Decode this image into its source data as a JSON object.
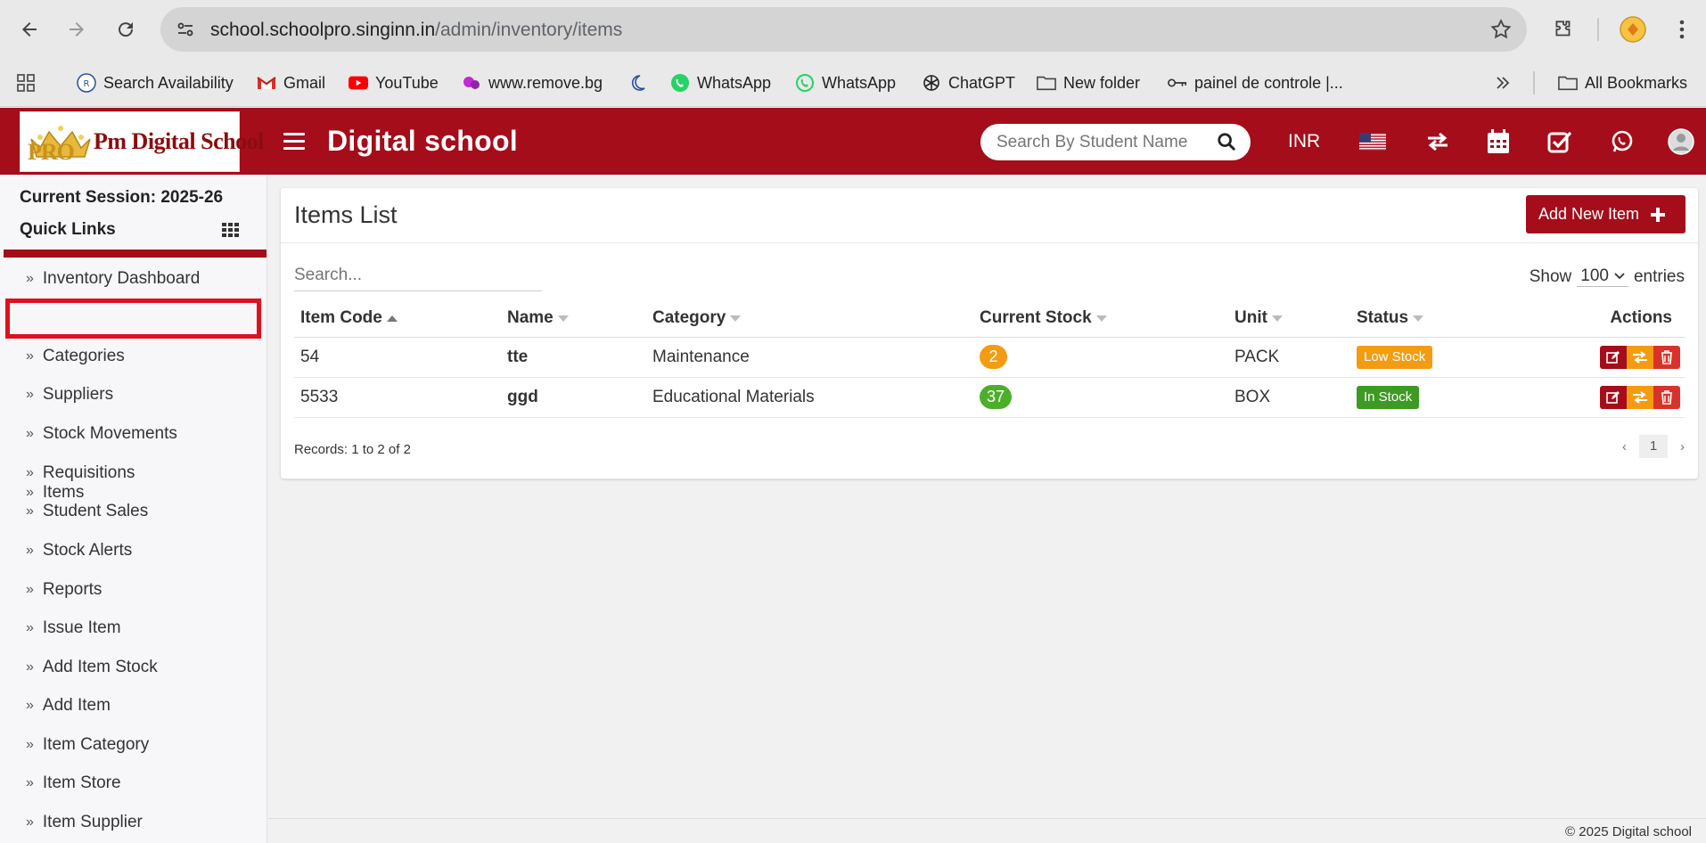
{
  "browser": {
    "url_host": "school.schoolpro.singinn.in",
    "url_path": "/admin/inventory/items"
  },
  "bookmarks": [
    {
      "label": "Search Availability",
      "icon": "ixigo-icon"
    },
    {
      "label": "Gmail",
      "icon": "gmail-icon"
    },
    {
      "label": "YouTube",
      "icon": "youtube-icon"
    },
    {
      "label": "www.remove.bg",
      "icon": "removebg-icon"
    },
    {
      "label": "",
      "icon": "moon-icon"
    },
    {
      "label": "WhatsApp",
      "icon": "whatsapp-icon"
    },
    {
      "label": "WhatsApp",
      "icon": "whatsapp-outline-icon"
    },
    {
      "label": "ChatGPT",
      "icon": "chatgpt-icon"
    },
    {
      "label": "New folder",
      "icon": "folder-icon"
    },
    {
      "label": "painel de controle |...",
      "icon": "key-icon"
    }
  ],
  "all_bookmarks": "All Bookmarks",
  "header": {
    "logo_text": "Pm Digital School",
    "logo_mark": "PRO",
    "title": "Digital school",
    "search_placeholder": "Search By Student Name",
    "currency": "INR"
  },
  "sidebar": {
    "session": "Current Session: 2025-26",
    "quick_links": "Quick Links",
    "items": [
      "Inventory Dashboard",
      "Items",
      "Categories",
      "Suppliers",
      "Stock Movements",
      "Requisitions",
      "Student Sales",
      "Stock Alerts",
      "Reports",
      "Issue Item",
      "Add Item Stock",
      "Add Item",
      "Item Category",
      "Item Store",
      "Item Supplier"
    ],
    "active_index": 1
  },
  "card": {
    "title": "Items List",
    "add_button": "Add New Item",
    "search_placeholder": "Search...",
    "show_label": "Show",
    "entries_value": "100",
    "entries_label": "entries",
    "columns": [
      "Item Code",
      "Name",
      "Category",
      "Current Stock",
      "Unit",
      "Status",
      "Actions"
    ],
    "rows": [
      {
        "code": "54",
        "name": "tte",
        "category": "Maintenance",
        "stock": "2",
        "stock_color": "#f39c12",
        "unit": "PACK",
        "status": "Low Stock",
        "status_color": "#f39c12"
      },
      {
        "code": "5533",
        "name": "ggd",
        "category": "Educational Materials",
        "stock": "37",
        "stock_color": "#4caf2a",
        "unit": "BOX",
        "status": "In Stock",
        "status_color": "#3d9a22"
      }
    ],
    "records": "Records: 1 to 2 of 2",
    "page": "1"
  },
  "footer": "© 2025 Digital school",
  "colors": {
    "brand": "#a50d1a",
    "edit": "#a50d1a",
    "transfer": "#f39c12",
    "delete": "#d9322a"
  }
}
